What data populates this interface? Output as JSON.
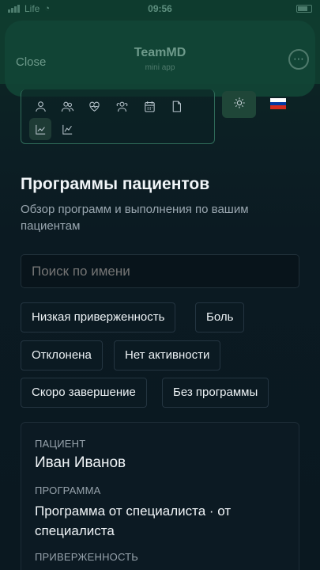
{
  "status": {
    "carrier": "Life",
    "time": "09:56"
  },
  "header": {
    "close_label": "Close",
    "title": "TeamMD",
    "subtitle": "mini app",
    "more_icon": "ellipsis-icon"
  },
  "nav": {
    "icons": [
      "user-icon",
      "users-icon",
      "heart-pulse-icon",
      "group-icon",
      "calendar-icon",
      "document-icon",
      "chart-line-icon",
      "chart-trend-icon"
    ],
    "active": "chart-line-icon",
    "theme_icon": "sun-icon",
    "language_flag_colors": [
      "#ffffff",
      "#0039a6",
      "#d52b1e"
    ]
  },
  "page": {
    "title": "Программы пациентов",
    "description": "Обзор программ и выполнения по вашим пациентам"
  },
  "search": {
    "placeholder": "Поиск по имени",
    "value": ""
  },
  "filters": [
    "Низкая приверженность",
    "Боль",
    "Отклонена",
    "Нет активности",
    "Скоро завершение",
    "Без программы"
  ],
  "patient_card": {
    "patient_label": "ПАЦИЕНТ",
    "patient_name": "Иван Иванов",
    "program_label": "ПРОГРАММА",
    "program_value": "Программа от специалиста · от специалиста",
    "adherence_label": "ПРИВЕРЖЕННОСТЬ"
  },
  "colors": {
    "header_bg": "#0f3b2e",
    "accent": "#2f6b59",
    "page_bg": "#0b1a22"
  }
}
